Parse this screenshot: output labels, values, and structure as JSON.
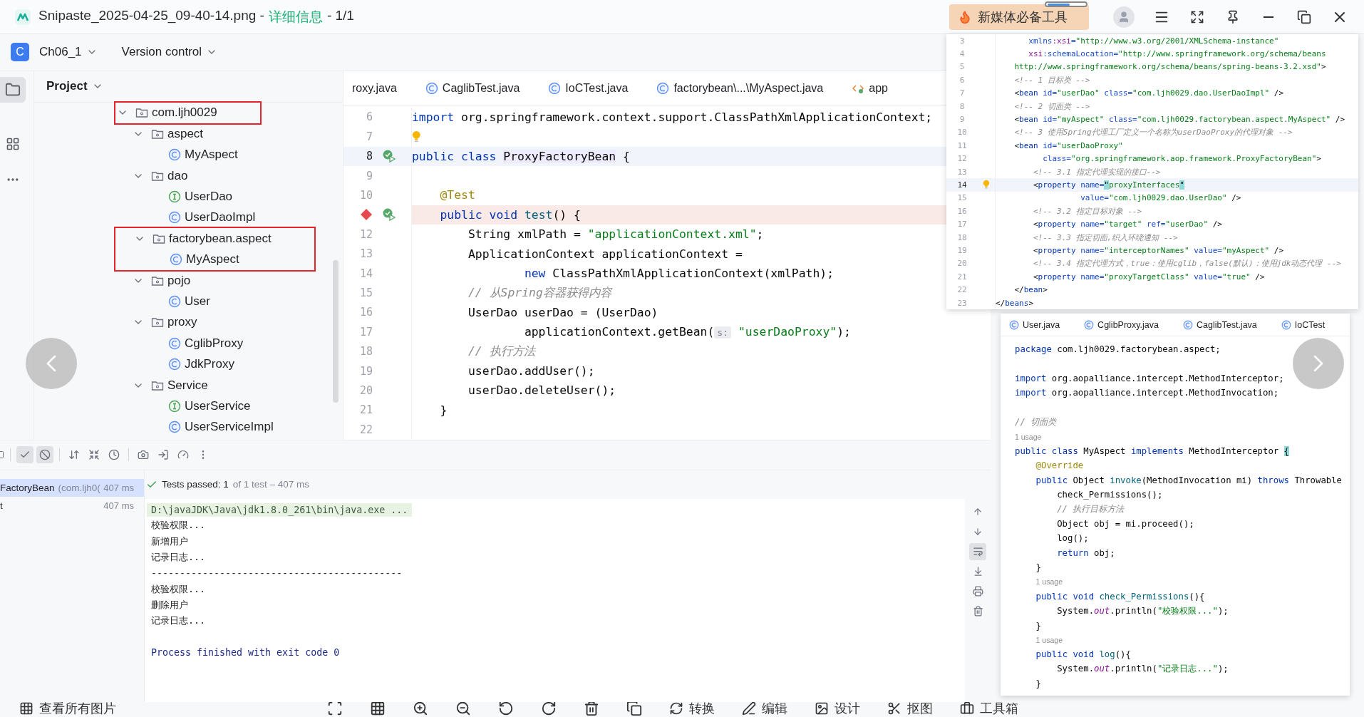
{
  "window": {
    "file": "Snipaste_2025-04-25_09-40-14.png -",
    "mode": "详细信息",
    "position": "- 1/1",
    "promo": "新媒体必备工具"
  },
  "ide": {
    "project": {
      "badge": "C",
      "name": "Ch06_1"
    },
    "vcs": "Version control",
    "panel_title": "Project",
    "tree": [
      {
        "label": "com.ljh0029",
        "kind": "package",
        "expanded": true,
        "boxed": true,
        "children": [
          {
            "label": "aspect",
            "kind": "package",
            "expanded": true,
            "boxed": false,
            "children": [
              {
                "label": "MyAspect",
                "kind": "class",
                "boxed": false
              }
            ]
          },
          {
            "label": "dao",
            "kind": "package",
            "expanded": true,
            "boxed": false,
            "children": [
              {
                "label": "UserDao",
                "kind": "interface",
                "boxed": false
              },
              {
                "label": "UserDaoImpl",
                "kind": "class",
                "boxed": false
              }
            ]
          },
          {
            "label": "factorybean.aspect",
            "kind": "package",
            "expanded": true,
            "boxed": true,
            "children": [
              {
                "label": "MyAspect",
                "kind": "class",
                "boxed": true
              }
            ]
          },
          {
            "label": "pojo",
            "kind": "package",
            "expanded": true,
            "boxed": false,
            "children": [
              {
                "label": "User",
                "kind": "class",
                "boxed": false
              }
            ]
          },
          {
            "label": "proxy",
            "kind": "package",
            "expanded": true,
            "boxed": false,
            "children": [
              {
                "label": "CglibProxy",
                "kind": "class",
                "boxed": false
              },
              {
                "label": "JdkProxy",
                "kind": "class",
                "boxed": false
              }
            ]
          },
          {
            "label": "Service",
            "kind": "package",
            "expanded": true,
            "boxed": false,
            "children": [
              {
                "label": "UserService",
                "kind": "interface",
                "boxed": false
              },
              {
                "label": "UserServiceImpl",
                "kind": "class",
                "boxed": false
              }
            ]
          }
        ]
      }
    ],
    "tabs": [
      {
        "label": "roxy.java",
        "kind": "plain"
      },
      {
        "label": "CaglibTest.java",
        "kind": "class"
      },
      {
        "label": "IoCTest.java",
        "kind": "class"
      },
      {
        "label": "factorybean\\...\\MyAspect.java",
        "kind": "class"
      },
      {
        "label": "app",
        "kind": "xml"
      }
    ],
    "lines": [
      {
        "number": "6",
        "caret": false,
        "breakpoint": false,
        "runnable": false,
        "intention": false,
        "tokens": [
          {
            "kind": "keyword",
            "text": "import"
          },
          {
            "kind": "plain",
            "text": " org.springframework.context.support.ClassPathXmlApplicationContext;"
          }
        ]
      },
      {
        "number": "7",
        "caret": false,
        "breakpoint": false,
        "runnable": false,
        "intention": true
      },
      {
        "number": "8",
        "caret": true,
        "breakpoint": false,
        "runnable": true,
        "intention": false,
        "tokens": [
          {
            "kind": "keyword",
            "text": "public class "
          },
          {
            "kind": "decl",
            "text": "ProxyFactoryBean"
          },
          {
            "kind": "plain",
            "text": " {"
          }
        ]
      },
      {
        "number": "9",
        "caret": false,
        "breakpoint": false,
        "runnable": false,
        "intention": false
      },
      {
        "number": "10",
        "caret": false,
        "breakpoint": false,
        "runnable": false,
        "intention": false,
        "tokens": [
          {
            "kind": "annotation",
            "text": "    @Test"
          }
        ]
      },
      {
        "caret": false,
        "breakpoint": true,
        "runnable": true,
        "intention": false,
        "tokens": [
          {
            "kind": "keyword",
            "text": "    public void "
          },
          {
            "kind": "method",
            "text": "test"
          },
          {
            "kind": "plain",
            "text": "() {"
          }
        ]
      },
      {
        "number": "12",
        "caret": false,
        "breakpoint": false,
        "runnable": false,
        "intention": false,
        "tokens": [
          {
            "kind": "plain",
            "text": "        String xmlPath = "
          },
          {
            "kind": "string",
            "text": "\"applicationContext.xml\""
          },
          {
            "kind": "plain",
            "text": ";"
          }
        ]
      },
      {
        "number": "13",
        "caret": false,
        "breakpoint": false,
        "runnable": false,
        "intention": false,
        "tokens": [
          {
            "kind": "plain",
            "text": "        ApplicationContext applicationContext ="
          }
        ]
      },
      {
        "number": "14",
        "caret": false,
        "breakpoint": false,
        "runnable": false,
        "intention": false,
        "tokens": [
          {
            "kind": "keyword",
            "text": "                new"
          },
          {
            "kind": "plain",
            "text": " ClassPathXmlApplicationContext(xmlPath);"
          }
        ]
      },
      {
        "number": "15",
        "caret": false,
        "breakpoint": false,
        "runnable": false,
        "intention": false,
        "tokens": [
          {
            "kind": "comment",
            "text": "        // 从Spring容器获得内容"
          }
        ]
      },
      {
        "number": "16",
        "caret": false,
        "breakpoint": false,
        "runnable": false,
        "intention": false,
        "tokens": [
          {
            "kind": "plain",
            "text": "        UserDao userDao = (UserDao)"
          }
        ]
      },
      {
        "number": "17",
        "caret": false,
        "breakpoint": false,
        "runnable": false,
        "intention": false,
        "tokens": [
          {
            "kind": "plain",
            "text": "                applicationContext.getBean("
          },
          {
            "kind": "hint",
            "text": "s:"
          },
          {
            "kind": "string",
            "text": " \"userDaoProxy\""
          },
          {
            "kind": "plain",
            "text": ");"
          }
        ]
      },
      {
        "number": "18",
        "caret": false,
        "breakpoint": false,
        "runnable": false,
        "intention": false,
        "tokens": [
          {
            "kind": "comment",
            "text": "        // 执行方法"
          }
        ]
      },
      {
        "number": "19",
        "caret": false,
        "breakpoint": false,
        "runnable": false,
        "intention": false,
        "tokens": [
          {
            "kind": "plain",
            "text": "        userDao.addUser();"
          }
        ]
      },
      {
        "number": "20",
        "caret": false,
        "breakpoint": false,
        "runnable": false,
        "intention": false,
        "tokens": [
          {
            "kind": "plain",
            "text": "        userDao.deleteUser();"
          }
        ]
      },
      {
        "number": "21",
        "caret": false,
        "breakpoint": false,
        "runnable": false,
        "intention": false,
        "tokens": [
          {
            "kind": "plain",
            "text": "    }"
          }
        ]
      },
      {
        "number": "22",
        "caret": false,
        "breakpoint": false,
        "runnable": false,
        "intention": false
      }
    ],
    "run_panel": {
      "toggles": [
        {
          "kind": "passed",
          "on": true
        },
        {
          "kind": "ignored",
          "on": true
        }
      ],
      "tests": [
        {
          "name": "FactoryBean",
          "detail": "(com.ljh0(",
          "time": "407 ms",
          "selected": true
        },
        {
          "name": "t",
          "time": "407 ms",
          "selected": false
        }
      ],
      "status": "Tests passed: 1",
      "status_detail": "of 1 test – 407 ms",
      "soft_wrap": true,
      "console": [
        {
          "kind": "command",
          "text": "D:\\javaJDK\\Java\\jdk1.8.0_261\\bin\\java.exe ..."
        },
        {
          "kind": "output",
          "text": "校验权限..."
        },
        {
          "kind": "output",
          "text": "新增用户"
        },
        {
          "kind": "output",
          "text": "记录日志..."
        },
        {
          "kind": "output",
          "text": "--------------------------------------------"
        },
        {
          "kind": "output",
          "text": "校验权限..."
        },
        {
          "kind": "output",
          "text": "删除用户"
        },
        {
          "kind": "output",
          "text": "记录日志..."
        },
        {
          "kind": "blank"
        },
        {
          "kind": "exit",
          "text": "Process finished with exit code 0"
        }
      ]
    }
  },
  "xml_snippet": {
    "lines": [
      {
        "number": "3",
        "caret": false,
        "intention": false,
        "tokens": [
          {
            "kind": "attr",
            "text": "       xmlns"
          },
          {
            "kind": "ns",
            "text": ":xsi"
          },
          {
            "kind": "attr",
            "text": "="
          },
          {
            "kind": "string",
            "text": "\"http://www.w3.org/2001/XMLSchema-instance\""
          }
        ]
      },
      {
        "number": "4",
        "caret": false,
        "intention": false,
        "tokens": [
          {
            "kind": "ns",
            "text": "       xsi"
          },
          {
            "kind": "attr",
            "text": ":schemaLocation="
          },
          {
            "kind": "string",
            "text": "\"http://www.springframework.org/schema/beans"
          }
        ]
      },
      {
        "number": "5",
        "caret": false,
        "intention": false,
        "tokens": [
          {
            "kind": "string",
            "text": "    http://www.springframework.org/schema/beans/spring-beans-3.2.xsd\""
          },
          {
            "kind": "plain",
            "text": ">"
          }
        ]
      },
      {
        "number": "6",
        "caret": false,
        "intention": false,
        "tokens": [
          {
            "kind": "comment",
            "text": "    <!-- 1 目标类 -->"
          }
        ]
      },
      {
        "number": "7",
        "caret": false,
        "intention": false,
        "tokens": [
          {
            "kind": "plain",
            "text": "    <"
          },
          {
            "kind": "tag",
            "text": "bean "
          },
          {
            "kind": "attr",
            "text": "id="
          },
          {
            "kind": "string",
            "text": "\"userDao\" "
          },
          {
            "kind": "attr",
            "text": "class="
          },
          {
            "kind": "string",
            "text": "\"com.ljh0029.dao.UserDaoImpl\""
          },
          {
            "kind": "plain",
            "text": " />"
          }
        ]
      },
      {
        "number": "8",
        "caret": false,
        "intention": false,
        "tokens": [
          {
            "kind": "comment",
            "text": "    <!-- 2 切面类 -->"
          }
        ]
      },
      {
        "number": "9",
        "caret": false,
        "intention": false,
        "tokens": [
          {
            "kind": "plain",
            "text": "    <"
          },
          {
            "kind": "tag",
            "text": "bean "
          },
          {
            "kind": "attr",
            "text": "id="
          },
          {
            "kind": "string",
            "text": "\"myAspect\" "
          },
          {
            "kind": "attr",
            "text": "class="
          },
          {
            "kind": "string",
            "text": "\"com.ljh0029.factorybean.aspect.MyAspect\""
          },
          {
            "kind": "plain",
            "text": " />"
          }
        ]
      },
      {
        "number": "10",
        "caret": false,
        "intention": false,
        "tokens": [
          {
            "kind": "comment",
            "text": "    <!-- 3 使用Spring代理工厂定义一个名称为userDaoProxy的代理对象 -->"
          }
        ]
      },
      {
        "number": "11",
        "caret": false,
        "intention": false,
        "tokens": [
          {
            "kind": "plain",
            "text": "    <"
          },
          {
            "kind": "tag",
            "text": "bean "
          },
          {
            "kind": "attr",
            "text": "id="
          },
          {
            "kind": "string",
            "text": "\"userDaoProxy\""
          }
        ]
      },
      {
        "number": "12",
        "caret": false,
        "intention": false,
        "tokens": [
          {
            "kind": "attr",
            "text": "          class="
          },
          {
            "kind": "string",
            "text": "\"org.springframework.aop.framework.ProxyFactoryBean\""
          },
          {
            "kind": "plain",
            "text": ">"
          }
        ]
      },
      {
        "number": "13",
        "caret": false,
        "intention": false,
        "tokens": [
          {
            "kind": "comment",
            "text": "        <!-- 3.1 指定代理实现的接口-->"
          }
        ]
      },
      {
        "number": "14",
        "caret": true,
        "intention": true,
        "tokens": [
          {
            "kind": "plain",
            "text": "        <"
          },
          {
            "kind": "tag",
            "text": "property "
          },
          {
            "kind": "attr",
            "text": "name="
          },
          {
            "kind": "match",
            "text": "\""
          },
          {
            "kind": "string",
            "text": "proxyInterfaces"
          },
          {
            "kind": "match",
            "text": "\""
          }
        ]
      },
      {
        "number": "15",
        "caret": false,
        "intention": false,
        "tokens": [
          {
            "kind": "attr",
            "text": "                  value="
          },
          {
            "kind": "string",
            "text": "\"com.ljh0029.dao.UserDao\""
          },
          {
            "kind": "plain",
            "text": " />"
          }
        ]
      },
      {
        "number": "16",
        "caret": false,
        "intention": false,
        "tokens": [
          {
            "kind": "comment",
            "text": "        <!-- 3.2 指定目标对象 -->"
          }
        ]
      },
      {
        "number": "17",
        "caret": false,
        "intention": false,
        "tokens": [
          {
            "kind": "plain",
            "text": "        <"
          },
          {
            "kind": "tag",
            "text": "property "
          },
          {
            "kind": "attr",
            "text": "name="
          },
          {
            "kind": "string",
            "text": "\"target\" "
          },
          {
            "kind": "attr",
            "text": "ref="
          },
          {
            "kind": "string",
            "text": "\"userDao\""
          },
          {
            "kind": "plain",
            "text": " />"
          }
        ]
      },
      {
        "number": "18",
        "caret": false,
        "intention": false,
        "tokens": [
          {
            "kind": "comment",
            "text": "        <!-- 3.3 指定切面,织入环绕通知 -->"
          }
        ]
      },
      {
        "number": "19",
        "caret": false,
        "intention": false,
        "tokens": [
          {
            "kind": "plain",
            "text": "        <"
          },
          {
            "kind": "tag",
            "text": "property "
          },
          {
            "kind": "attr",
            "text": "name="
          },
          {
            "kind": "string",
            "text": "\"interceptorNames\" "
          },
          {
            "kind": "attr",
            "text": "value="
          },
          {
            "kind": "string",
            "text": "\"myAspect\""
          },
          {
            "kind": "plain",
            "text": " />"
          }
        ]
      },
      {
        "number": "20",
        "caret": false,
        "intention": false,
        "tokens": [
          {
            "kind": "comment",
            "text": "        <!-- 3.4 指定代理方式，true：使用cglib，false(默认)：使用jdk动态代理 -->"
          }
        ]
      },
      {
        "number": "21",
        "caret": false,
        "intention": false,
        "tokens": [
          {
            "kind": "plain",
            "text": "        <"
          },
          {
            "kind": "tag",
            "text": "property "
          },
          {
            "kind": "attr",
            "text": "name="
          },
          {
            "kind": "string",
            "text": "\"proxyTargetClass\" "
          },
          {
            "kind": "attr",
            "text": "value="
          },
          {
            "kind": "string",
            "text": "\"true\""
          },
          {
            "kind": "plain",
            "text": " />"
          }
        ]
      },
      {
        "number": "22",
        "caret": false,
        "intention": false,
        "tokens": [
          {
            "kind": "plain",
            "text": "    </"
          },
          {
            "kind": "tag",
            "text": "bean"
          },
          {
            "kind": "plain",
            "text": ">"
          }
        ]
      },
      {
        "number": "23",
        "caret": false,
        "intention": false,
        "tokens": [
          {
            "kind": "plain",
            "text": "</"
          },
          {
            "kind": "tag",
            "text": "beans"
          },
          {
            "kind": "plain",
            "text": ">"
          }
        ]
      }
    ]
  },
  "java_snippet": {
    "tabs": [
      {
        "label": "User.java",
        "kind": "class"
      },
      {
        "label": "CglibProxy.java",
        "kind": "class"
      },
      {
        "label": "CaglibTest.java",
        "kind": "class"
      },
      {
        "label": "IoCTest",
        "kind": "class"
      }
    ],
    "lines": [
      {
        "kind": "code",
        "tokens": [
          {
            "kind": "keyword",
            "text": "package"
          },
          {
            "kind": "plain",
            "text": " com.ljh0029.factorybean.aspect;"
          }
        ]
      },
      {
        "kind": "code"
      },
      {
        "kind": "code",
        "tokens": [
          {
            "kind": "keyword",
            "text": "import"
          },
          {
            "kind": "plain",
            "text": " org.aopalliance.intercept.MethodInterceptor;"
          }
        ]
      },
      {
        "kind": "code",
        "tokens": [
          {
            "kind": "keyword",
            "text": "import"
          },
          {
            "kind": "plain",
            "text": " org.aopalliance.intercept.MethodInvocation;"
          }
        ]
      },
      {
        "kind": "code"
      },
      {
        "kind": "code",
        "tokens": [
          {
            "kind": "comment",
            "text": "// 切面类"
          }
        ]
      },
      {
        "kind": "usage",
        "text": "1 usage"
      },
      {
        "kind": "code",
        "tokens": [
          {
            "kind": "keyword",
            "text": "public class "
          },
          {
            "kind": "plain",
            "text": "MyAspect "
          },
          {
            "kind": "keyword",
            "text": "implements "
          },
          {
            "kind": "plain",
            "text": "MethodInterceptor "
          },
          {
            "kind": "match",
            "text": "{"
          }
        ]
      },
      {
        "kind": "code",
        "tokens": [
          {
            "kind": "annotation",
            "text": "    @Override"
          }
        ]
      },
      {
        "kind": "code",
        "tokens": [
          {
            "kind": "keyword",
            "text": "    public "
          },
          {
            "kind": "plain",
            "text": "Object "
          },
          {
            "kind": "method",
            "text": "invoke"
          },
          {
            "kind": "plain",
            "text": "(MethodInvocation mi) "
          },
          {
            "kind": "keyword",
            "text": "throws "
          },
          {
            "kind": "plain",
            "text": "Throwable"
          }
        ]
      },
      {
        "kind": "code",
        "tokens": [
          {
            "kind": "plain",
            "text": "        check_Permissions();"
          }
        ]
      },
      {
        "kind": "code",
        "tokens": [
          {
            "kind": "comment",
            "text": "        // 执行目标方法"
          }
        ]
      },
      {
        "kind": "code",
        "tokens": [
          {
            "kind": "plain",
            "text": "        Object obj = mi.proceed();"
          }
        ]
      },
      {
        "kind": "code",
        "tokens": [
          {
            "kind": "plain",
            "text": "        log();"
          }
        ]
      },
      {
        "kind": "code",
        "tokens": [
          {
            "kind": "keyword",
            "text": "        return"
          },
          {
            "kind": "plain",
            "text": " obj;"
          }
        ]
      },
      {
        "kind": "code",
        "tokens": [
          {
            "kind": "plain",
            "text": "    }"
          }
        ]
      },
      {
        "kind": "usage",
        "text": "    1 usage"
      },
      {
        "kind": "code",
        "tokens": [
          {
            "kind": "keyword",
            "text": "    public void "
          },
          {
            "kind": "method",
            "text": "check_Permissions"
          },
          {
            "kind": "plain",
            "text": "(){"
          }
        ]
      },
      {
        "kind": "code",
        "tokens": [
          {
            "kind": "plain",
            "text": "        System."
          },
          {
            "kind": "field",
            "text": "out"
          },
          {
            "kind": "plain",
            "text": ".println("
          },
          {
            "kind": "string",
            "text": "\"校验权限...\""
          },
          {
            "kind": "plain",
            "text": ");"
          }
        ]
      },
      {
        "kind": "code",
        "tokens": [
          {
            "kind": "plain",
            "text": "    }"
          }
        ]
      },
      {
        "kind": "usage",
        "text": "    1 usage"
      },
      {
        "kind": "code",
        "tokens": [
          {
            "kind": "keyword",
            "text": "    public void "
          },
          {
            "kind": "method",
            "text": "log"
          },
          {
            "kind": "plain",
            "text": "(){"
          }
        ]
      },
      {
        "kind": "code",
        "tokens": [
          {
            "kind": "plain",
            "text": "        System."
          },
          {
            "kind": "field",
            "text": "out"
          },
          {
            "kind": "plain",
            "text": ".println("
          },
          {
            "kind": "string",
            "text": "\"记录日志...\""
          },
          {
            "kind": "plain",
            "text": ");"
          }
        ]
      },
      {
        "kind": "code",
        "tokens": [
          {
            "kind": "plain",
            "text": "    }"
          }
        ]
      }
    ]
  },
  "viewer_toolbar": [
    {
      "kind": "all",
      "label": "查看所有图片"
    },
    {
      "kind": "convert",
      "label": "转换"
    },
    {
      "kind": "edit",
      "label": "编辑"
    },
    {
      "kind": "design",
      "label": "设计"
    },
    {
      "kind": "cutout",
      "label": "抠图"
    },
    {
      "kind": "toolbox",
      "label": "工具箱"
    }
  ]
}
